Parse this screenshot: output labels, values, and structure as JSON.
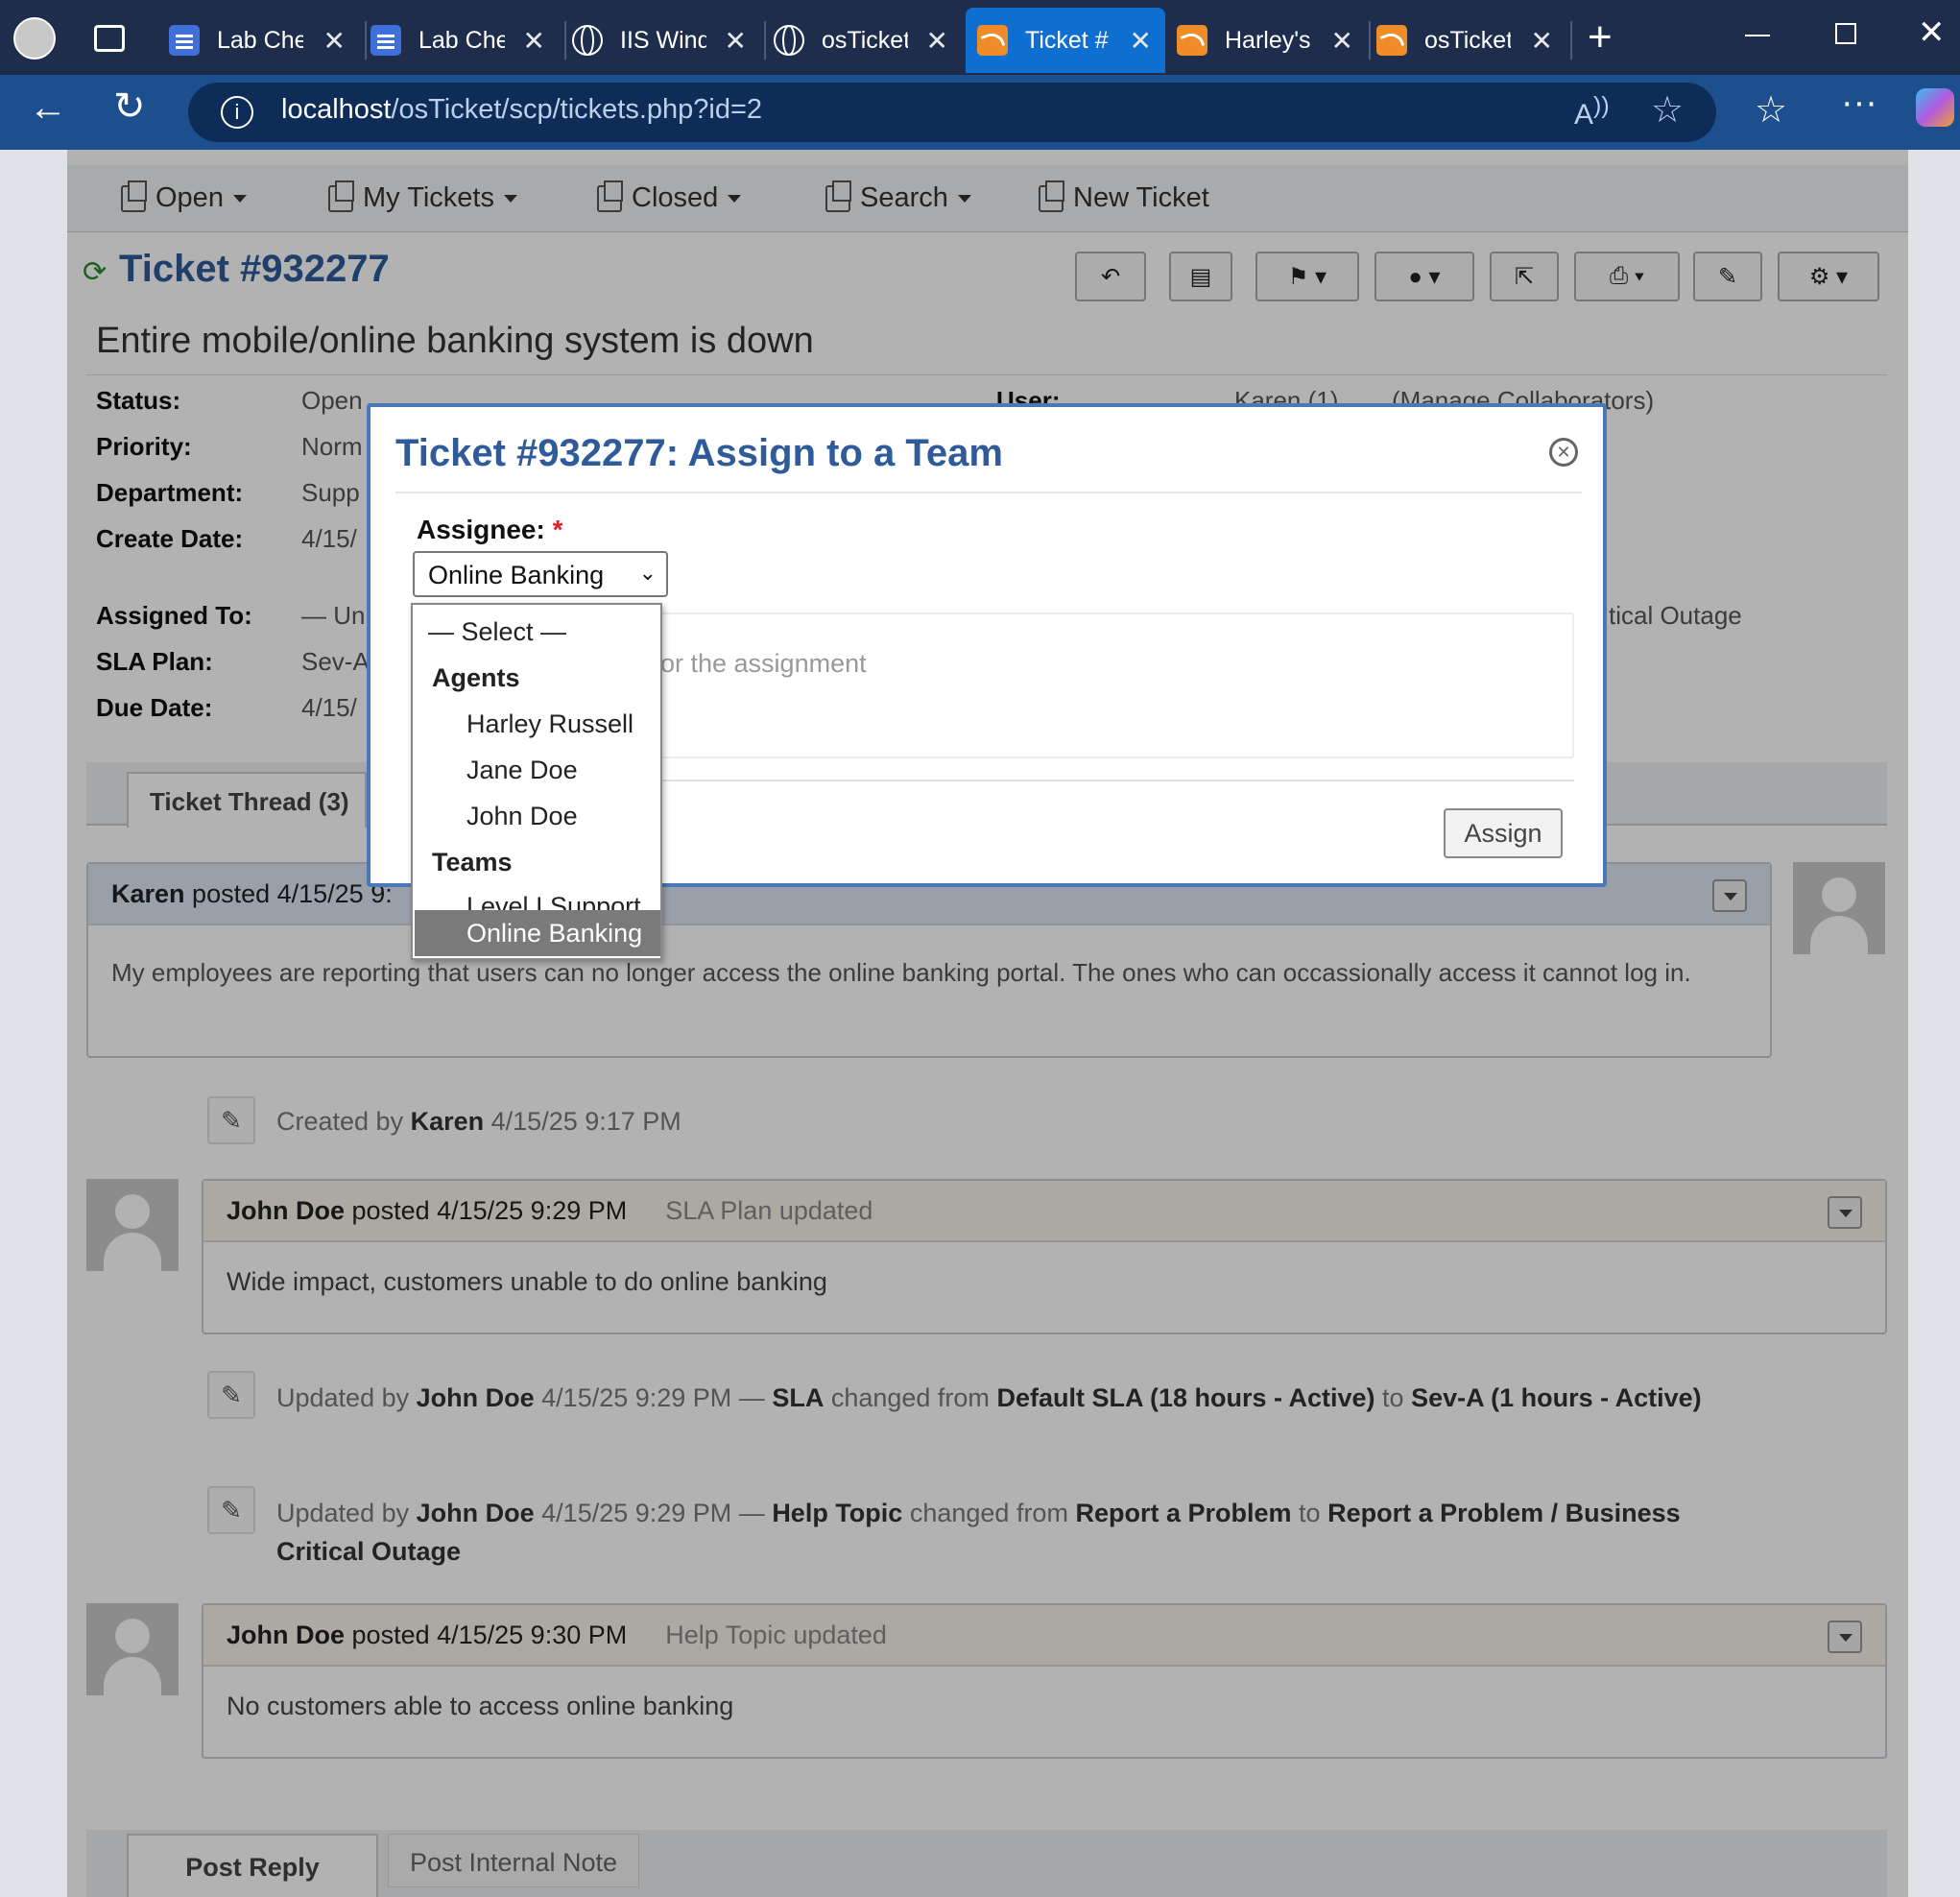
{
  "browser": {
    "tabs": [
      {
        "label": "Lab Che",
        "icon": "document-icon"
      },
      {
        "label": "Lab Che",
        "icon": "document-icon"
      },
      {
        "label": "IIS Wind",
        "icon": "globe-icon"
      },
      {
        "label": "osTicket",
        "icon": "globe-icon"
      },
      {
        "label": "Ticket #",
        "icon": "osticket-icon",
        "active": true
      },
      {
        "label": "Harley's",
        "icon": "osticket-icon"
      },
      {
        "label": "osTicket",
        "icon": "osticket-icon"
      }
    ],
    "url_host": "localhost",
    "url_path": "/osTicket/scp/tickets.php?id=2"
  },
  "nav": {
    "open": "Open",
    "my_tickets": "My Tickets",
    "closed": "Closed",
    "search": "Search",
    "new_ticket": "New Ticket"
  },
  "ticket": {
    "number": "Ticket #932277",
    "subject": "Entire mobile/online banking system is down",
    "labels": {
      "status": "Status:",
      "priority": "Priority:",
      "department": "Department:",
      "create_date": "Create Date:",
      "assigned_to": "Assigned To:",
      "sla_plan": "SLA Plan:",
      "due_date": "Due Date:",
      "user": "User:"
    },
    "values": {
      "status": "Open",
      "priority": "Norm",
      "department": "Supp",
      "create_date": "4/15/",
      "assigned_to": "— Un",
      "sla_plan": "Sev-A",
      "due_date": "4/15/",
      "user": "Karen (1)",
      "collab": "(Manage Collaborators)",
      "help_topic": "tical Outage"
    }
  },
  "tabs": {
    "thread": "Ticket Thread (3)",
    "post_reply": "Post Reply",
    "internal_note": "Post Internal Note"
  },
  "thread": {
    "entry1": {
      "author": "Karen",
      "posted": "posted 4/15/25 9:",
      "body": "My employees are reporting that users can no longer access the online banking portal. The ones who can occassionally access it cannot log in."
    },
    "event1": {
      "prefix": "Created by",
      "author": "Karen",
      "time": "4/15/25 9:17 PM"
    },
    "entry2": {
      "author": "John Doe",
      "posted": "posted 4/15/25 9:29 PM",
      "title": "SLA Plan updated",
      "body": "Wide impact, customers unable to do online banking"
    },
    "event2": {
      "prefix": "Updated by",
      "author": "John Doe",
      "time": "4/15/25 9:29 PM —",
      "field": "SLA",
      "changed": "changed from",
      "from": "Default SLA (18 hours - Active)",
      "to_word": "to",
      "to": "Sev-A (1 hours - Active)"
    },
    "event3": {
      "prefix": "Updated by",
      "author": "John Doe",
      "time": "4/15/25 9:29 PM —",
      "field": "Help Topic",
      "changed": "changed from",
      "from": "Report a Problem",
      "to_word": "to",
      "to": "Report a Problem / Business Critical Outage"
    },
    "entry3": {
      "author": "John Doe",
      "posted": "posted 4/15/25 9:30 PM",
      "title": "Help Topic updated",
      "body": "No customers able to access online banking"
    }
  },
  "modal": {
    "title": "Ticket #932277: Assign to a Team",
    "assignee_label": "Assignee:",
    "required": "*",
    "selected": "Online Banking",
    "comment_placeholder": "or the assignment",
    "assign_button": "Assign",
    "dropdown": {
      "select": "— Select —",
      "agents_group": "Agents",
      "agents": [
        "Harley Russell",
        "Jane Doe",
        "John Doe"
      ],
      "teams_group": "Teams",
      "teams": [
        "Level I Support",
        "Online Banking"
      ]
    }
  },
  "colors": {
    "accent": "#2f5b9a",
    "tab_active": "#0f6fd0",
    "highlight": "#7a7a7a"
  }
}
